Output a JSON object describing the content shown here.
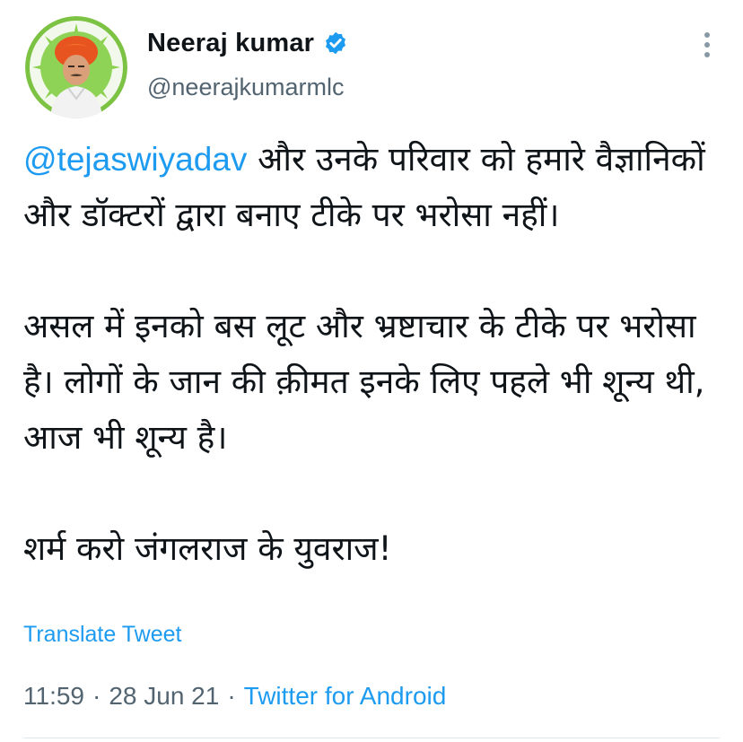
{
  "user": {
    "display_name": "Neeraj kumar",
    "handle": "@neerajkumarmlc",
    "verified": true,
    "avatar_icon": "profile-photo"
  },
  "tweet": {
    "mention": "@tejaswiyadav",
    "line1_rest": " और उनके परिवार को हमारे वैज्ञानिकों और डॉक्टरों द्वारा बनाए टीके पर भरोसा नहीं।",
    "paragraph2": "असल में इनको बस लूट और भ्रष्टाचार के टीके पर भरोसा है। लोगों के जान की क़ीमत इनके लिए पहले भी शून्य थी, आज भी शून्य है।",
    "paragraph3": "शर्म करो जंगलराज के युवराज!"
  },
  "translate_label": "Translate Tweet",
  "meta": {
    "time": "11:59",
    "separator": "·",
    "date": "28 Jun 21",
    "source": "Twitter for Android"
  },
  "colors": {
    "link": "#1d9bf0",
    "secondary": "#536471",
    "text": "#0f1419"
  }
}
